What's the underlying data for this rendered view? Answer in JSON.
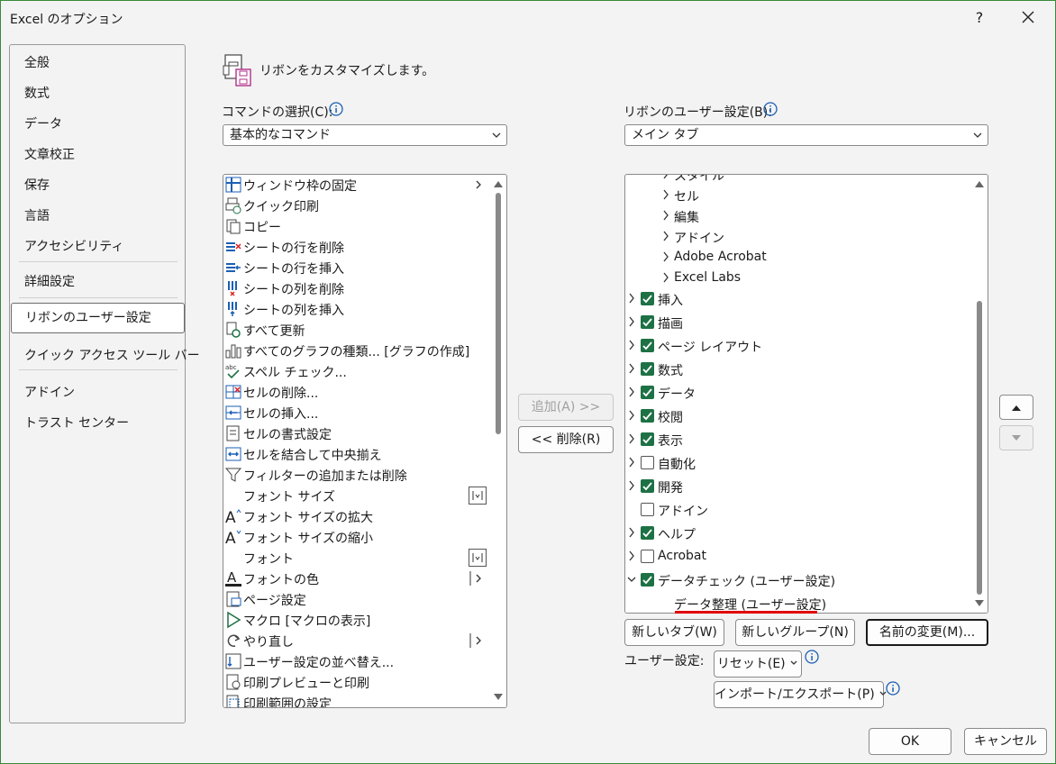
{
  "window": {
    "title": "Excel のオプション",
    "help_label": "?"
  },
  "nav": {
    "items": [
      {
        "label": "全般"
      },
      {
        "label": "数式"
      },
      {
        "label": "データ"
      },
      {
        "label": "文章校正"
      },
      {
        "label": "保存"
      },
      {
        "label": "言語"
      },
      {
        "label": "アクセシビリティ"
      },
      {
        "label": "詳細設定"
      },
      {
        "label": "リボンのユーザー設定",
        "active": true
      },
      {
        "label": "クイック アクセス ツール バー"
      },
      {
        "label": "アドイン"
      },
      {
        "label": "トラスト センター"
      }
    ]
  },
  "main": {
    "heading": "リボンをカスタマイズします。",
    "commands_label": "コマンドの選択(C):",
    "commands_value": "基本的なコマンド",
    "ribbon_label": "リボンのユーザー設定(B):",
    "ribbon_value": "メイン タブ"
  },
  "commands": [
    {
      "label": "ウィンドウ枠の固定",
      "icon": "freeze-panes-icon",
      "extra": "submenu"
    },
    {
      "label": "クイック印刷",
      "icon": "quick-print-icon"
    },
    {
      "label": "コピー",
      "icon": "copy-icon"
    },
    {
      "label": "シートの行を削除",
      "icon": "delete-row-icon"
    },
    {
      "label": "シートの行を挿入",
      "icon": "insert-row-icon"
    },
    {
      "label": "シートの列を削除",
      "icon": "delete-column-icon"
    },
    {
      "label": "シートの列を挿入",
      "icon": "insert-column-icon"
    },
    {
      "label": "すべて更新",
      "icon": "refresh-all-icon"
    },
    {
      "label": "すべてのグラフの種類... [グラフの作成]",
      "icon": "chart-icon"
    },
    {
      "label": "スペル チェック...",
      "icon": "spell-check-icon"
    },
    {
      "label": "セルの削除...",
      "icon": "delete-cells-icon"
    },
    {
      "label": "セルの挿入...",
      "icon": "insert-cells-icon"
    },
    {
      "label": "セルの書式設定",
      "icon": "format-cells-icon"
    },
    {
      "label": "セルを結合して中央揃え",
      "icon": "merge-center-icon"
    },
    {
      "label": "フィルターの追加または削除",
      "icon": "filter-icon"
    },
    {
      "label": "フォント サイズ",
      "icon": "",
      "extra": "dropdown"
    },
    {
      "label": "フォント サイズの拡大",
      "icon": "font-grow-icon"
    },
    {
      "label": "フォント サイズの縮小",
      "icon": "font-shrink-icon"
    },
    {
      "label": "フォント",
      "icon": "",
      "extra": "dropdown"
    },
    {
      "label": "フォントの色",
      "icon": "font-color-icon",
      "extra": "split"
    },
    {
      "label": "ページ設定",
      "icon": "page-setup-icon"
    },
    {
      "label": "マクロ [マクロの表示]",
      "icon": "macro-icon"
    },
    {
      "label": "やり直し",
      "icon": "redo-icon",
      "extra": "split"
    },
    {
      "label": "ユーザー設定の並べ替え...",
      "icon": "sort-icon"
    },
    {
      "label": "印刷プレビューと印刷",
      "icon": "print-preview-icon"
    },
    {
      "label": "印刷範囲の設定",
      "icon": "print-area-icon"
    }
  ],
  "tree": [
    {
      "label": "スタイル",
      "level": 1,
      "expander": "right",
      "checkbox": "none"
    },
    {
      "label": "セル",
      "level": 1,
      "expander": "right",
      "checkbox": "none"
    },
    {
      "label": "編集",
      "level": 1,
      "expander": "right",
      "checkbox": "none"
    },
    {
      "label": "アドイン",
      "level": 1,
      "expander": "right",
      "checkbox": "none"
    },
    {
      "label": "Adobe Acrobat",
      "level": 1,
      "expander": "right",
      "checkbox": "none"
    },
    {
      "label": "Excel Labs",
      "level": 1,
      "expander": "right",
      "checkbox": "none"
    },
    {
      "label": "挿入",
      "level": 0,
      "expander": "right",
      "checkbox": "on"
    },
    {
      "label": "描画",
      "level": 0,
      "expander": "right",
      "checkbox": "on"
    },
    {
      "label": "ページ レイアウト",
      "level": 0,
      "expander": "right",
      "checkbox": "on"
    },
    {
      "label": "数式",
      "level": 0,
      "expander": "right",
      "checkbox": "on"
    },
    {
      "label": "データ",
      "level": 0,
      "expander": "right",
      "checkbox": "on"
    },
    {
      "label": "校閲",
      "level": 0,
      "expander": "right",
      "checkbox": "on"
    },
    {
      "label": "表示",
      "level": 0,
      "expander": "right",
      "checkbox": "on"
    },
    {
      "label": "自動化",
      "level": 0,
      "expander": "right",
      "checkbox": "off"
    },
    {
      "label": "開発",
      "level": 0,
      "expander": "right",
      "checkbox": "on"
    },
    {
      "label": "アドイン",
      "level": 0,
      "expander": "none",
      "checkbox": "off"
    },
    {
      "label": "ヘルプ",
      "level": 0,
      "expander": "right",
      "checkbox": "on"
    },
    {
      "label": "Acrobat",
      "level": 0,
      "expander": "right",
      "checkbox": "off"
    },
    {
      "label": "データチェック (ユーザー設定)",
      "level": 0,
      "expander": "down",
      "checkbox": "on"
    },
    {
      "label": "データ整理 (ユーザー設定)",
      "level": 1,
      "expander": "none",
      "checkbox": "none",
      "selected": true
    }
  ],
  "buttons": {
    "add": "追加(A) >>",
    "remove": "<< 削除(R)",
    "new_tab": "新しいタブ(W)",
    "new_group": "新しいグループ(N)",
    "rename": "名前の変更(M)...",
    "user_settings_label": "ユーザー設定:",
    "reset": "リセット(E)",
    "import_export": "インポート/エクスポート(P)",
    "ok": "OK",
    "cancel": "キャンセル"
  },
  "colors": {
    "accent_check": "#1e7145",
    "highlight_underline": "#e00000",
    "window_border": "#3a8a3a"
  }
}
